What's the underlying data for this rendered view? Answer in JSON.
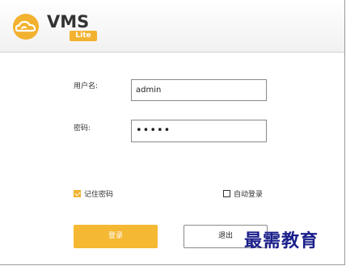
{
  "brand": {
    "name": "VMS",
    "edition": "Lite"
  },
  "form": {
    "username_label": "用户名:",
    "username_value": "admin",
    "password_label": "密码:",
    "password_value": "•••••"
  },
  "options": {
    "remember_label": "记住密码",
    "remember_checked": true,
    "autologin_label": "自动登录",
    "autologin_checked": false
  },
  "buttons": {
    "login": "登录",
    "exit": "退出"
  },
  "watermark": "最需教育",
  "colors": {
    "accent": "#f5b833",
    "watermark": "#1a1f8a"
  }
}
